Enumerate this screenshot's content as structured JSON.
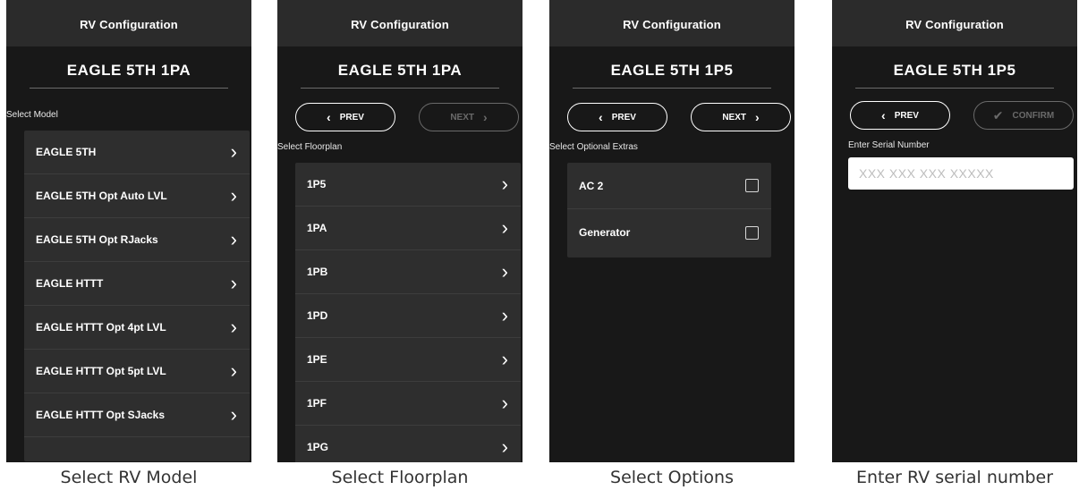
{
  "screens": [
    {
      "topbar_title": "RV Configuration",
      "model_title": "EAGLE 5TH 1PA",
      "section_label": "Select Model",
      "items": [
        "EAGLE 5TH",
        "EAGLE 5TH Opt Auto LVL",
        "EAGLE 5TH Opt RJacks",
        "EAGLE HTTT",
        "EAGLE HTTT Opt 4pt LVL",
        "EAGLE HTTT Opt 5pt LVL",
        "EAGLE HTTT Opt SJacks"
      ],
      "caption": "Select RV Model"
    },
    {
      "topbar_title": "RV Configuration",
      "model_title": "EAGLE 5TH 1PA",
      "prev_label": "PREV",
      "next_label": "NEXT",
      "section_label": "Select Floorplan",
      "items": [
        "1P5",
        "1PA",
        "1PB",
        "1PD",
        "1PE",
        "1PF",
        "1PG"
      ],
      "caption": "Select Floorplan"
    },
    {
      "topbar_title": "RV Configuration",
      "model_title": "EAGLE 5TH 1P5",
      "prev_label": "PREV",
      "next_label": "NEXT",
      "section_label": "Select Optional Extras",
      "items": [
        "AC 2",
        "Generator"
      ],
      "caption": "Select Options"
    },
    {
      "topbar_title": "RV Configuration",
      "model_title": "EAGLE 5TH 1P5",
      "prev_label": "PREV",
      "confirm_label": "CONFIRM",
      "section_label": "Enter Serial Number",
      "serial_placeholder": "XXX XXX XXX XXXXX",
      "caption": "Enter RV serial number"
    }
  ],
  "icons": {
    "chevron_right": "chevron-right-icon",
    "chevron_left": "chevron-left-icon",
    "check": "check-icon",
    "checkbox": "checkbox-icon"
  },
  "colors": {
    "screen_bg": "#181818",
    "topbar_bg": "#2b2b2b",
    "list_bg": "#2e2e2e",
    "disabled": "#6a6a6a",
    "text": "#ffffff"
  }
}
